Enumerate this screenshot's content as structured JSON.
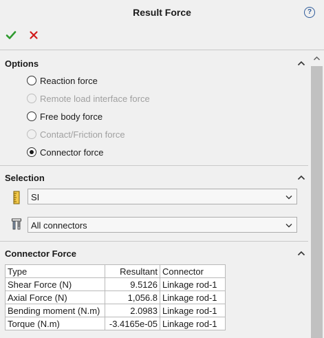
{
  "header": {
    "title": "Result Force",
    "help_label": "?"
  },
  "options": {
    "title": "Options",
    "radios": [
      {
        "label": "Reaction force",
        "enabled": true,
        "checked": false
      },
      {
        "label": "Remote load interface force",
        "enabled": false,
        "checked": false
      },
      {
        "label": "Free body force",
        "enabled": true,
        "checked": false
      },
      {
        "label": "Contact/Friction force",
        "enabled": false,
        "checked": false
      },
      {
        "label": "Connector force",
        "enabled": true,
        "checked": true
      }
    ]
  },
  "selection": {
    "title": "Selection",
    "units_value": "SI",
    "connectors_value": "All connectors"
  },
  "connector_force": {
    "title": "Connector Force",
    "columns": [
      "Type",
      "Resultant",
      "Connector"
    ],
    "rows": [
      [
        "Shear Force (N)",
        "9.5126",
        "Linkage rod-1"
      ],
      [
        "Axial Force (N)",
        "1,056.8",
        "Linkage rod-1"
      ],
      [
        "Bending moment (N.m)",
        "2.0983",
        "Linkage rod-1"
      ],
      [
        "Torque (N.m)",
        "-3.4165e-05",
        "Linkage rod-1"
      ]
    ]
  },
  "colors": {
    "ok": "#2e9a2e",
    "cancel": "#d11a1a",
    "background": "#f0f0f0"
  }
}
